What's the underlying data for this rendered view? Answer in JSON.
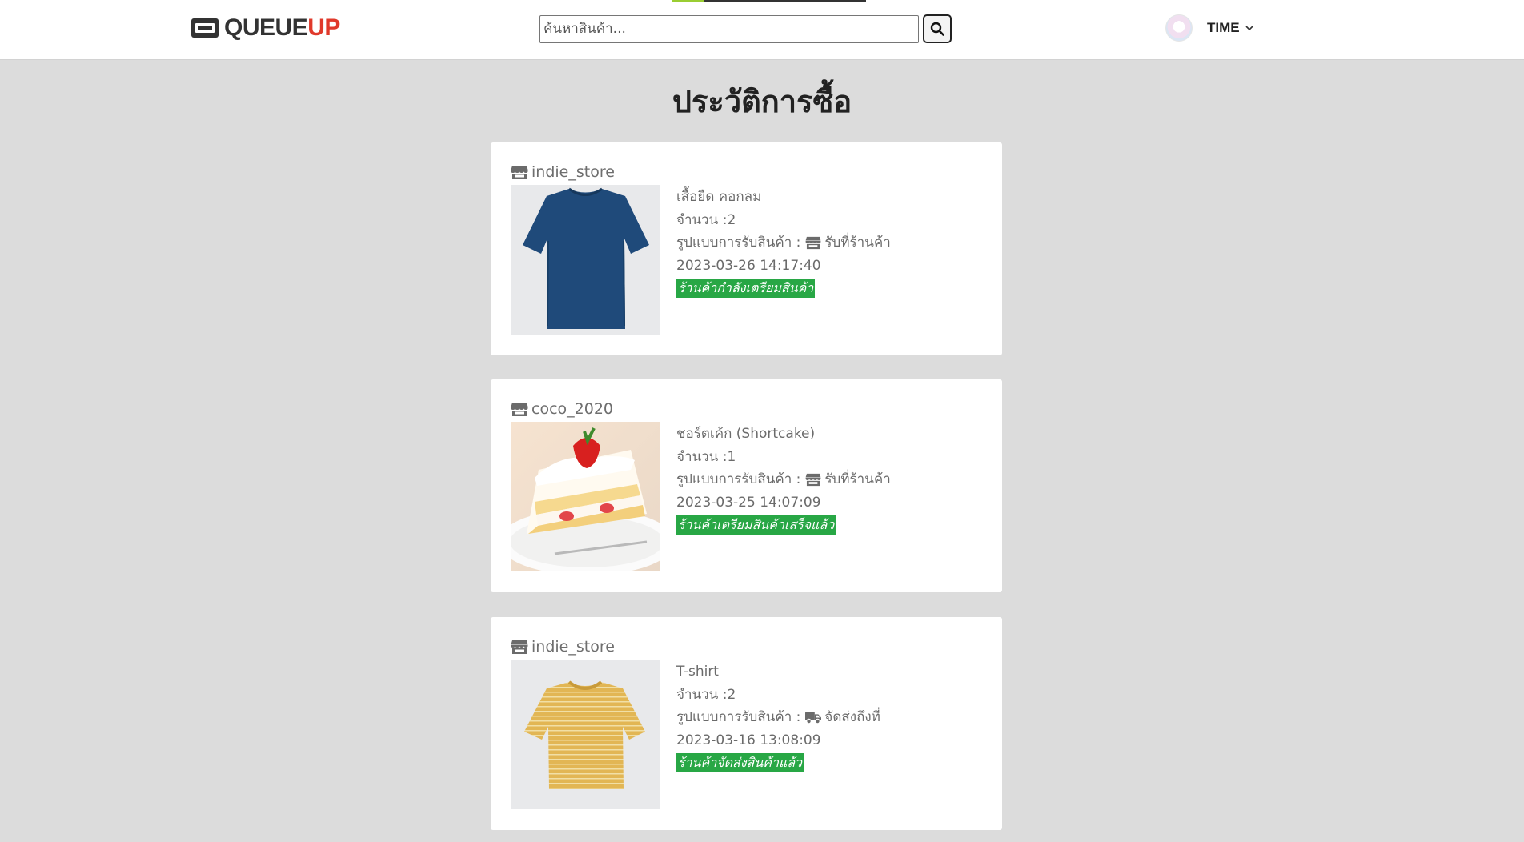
{
  "navbar": {
    "brand_part1": "QUEUE",
    "brand_part2": "UP",
    "brand_icon": "ticket-icon",
    "search_placeholder": "ค้นหาสินค้า...",
    "search_value": "",
    "search_icon": "search-icon",
    "user_name": "TIME",
    "user_menu_icon": "chevron-down-icon",
    "progress_fraction": 0.16
  },
  "page": {
    "title": "ประวัติการซื้อ"
  },
  "labels": {
    "quantity_prefix": "จำนวน : ",
    "delivery_prefix": "รูปแบบการรับสินค้า : "
  },
  "orders": [
    {
      "store": "indie_store",
      "product": "เสื้อยืด คอกลม",
      "quantity": "2",
      "delivery": "รับที่ร้านค้า",
      "delivery_icon": "store-icon",
      "datetime": "2023-03-26 14:17:40",
      "status": "ร้านค้ากำลังเตรียมสินค้า",
      "image": "navy-tshirt"
    },
    {
      "store": "coco_2020",
      "product": "ชอร์ตเค้ก (Shortcake)",
      "quantity": "1",
      "delivery": "รับที่ร้านค้า",
      "delivery_icon": "store-icon",
      "datetime": "2023-03-25 14:07:09",
      "status": "ร้านค้าเตรียมสินค้าเสร็จแล้ว",
      "image": "strawberry-shortcake"
    },
    {
      "store": "indie_store",
      "product": "T-shirt",
      "quantity": "2",
      "delivery": "จัดส่งถึงที่",
      "delivery_icon": "truck-icon",
      "datetime": "2023-03-16 13:08:09",
      "status": "ร้านค้าจัดส่งสินค้าแล้ว",
      "image": "yellow-striped-tshirt"
    }
  ],
  "colors": {
    "status_green": "#28a745",
    "brand_red": "#e0392b",
    "page_bg": "#dcdcdc"
  }
}
